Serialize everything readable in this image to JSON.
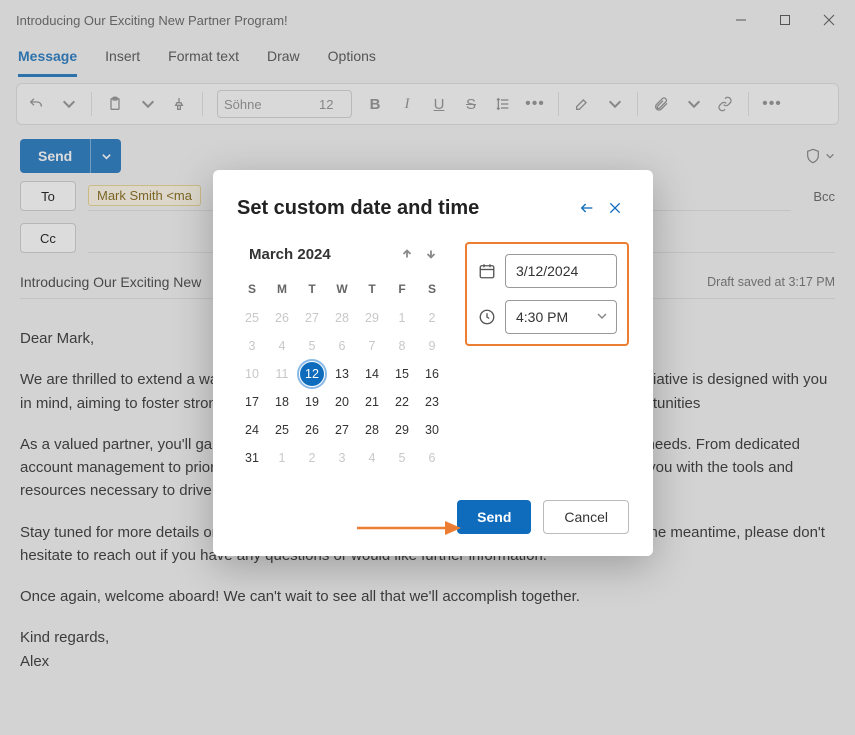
{
  "window": {
    "title": "Introducing Our Exciting New Partner Program!"
  },
  "tabs": {
    "items": [
      "Message",
      "Insert",
      "Format text",
      "Draw",
      "Options"
    ],
    "active": 0
  },
  "ribbon": {
    "font_name": "Söhne",
    "font_size": "12"
  },
  "send": {
    "label": "Send"
  },
  "recipients": {
    "to_label": "To",
    "cc_label": "Cc",
    "bcc_label": "Bcc",
    "to_chip": "Mark Smith <ma"
  },
  "subject": {
    "value": "Introducing Our Exciting New",
    "draft_note": "Draft saved at 3:17 PM"
  },
  "body": {
    "greeting": "Dear Mark,",
    "p1": "We are thrilled to extend a warm welcome to you as a member of our Partner Program! This initiative is designed with you in mind, aiming to foster strong, mutually beneficial relationships, and create unparalleled opportunities",
    "p2": "As a valued partner, you'll gain access to an array of exclusive benefits tailored to your unique needs. From dedicated account management to priority support and customized service, we're committed to providing you with the tools and resources necessary to drive your business landscape.",
    "p3": "Stay tuned for more details on upcoming events, webinars, and exclusive Partner Program. In the meantime, please don't hesitate to reach out if you have any questions or would like further information.",
    "p4": "Once again, welcome aboard! We can't wait to see all that we'll accomplish together.",
    "signoff": "Kind regards,\nAlex"
  },
  "modal": {
    "title": "Set custom date and time",
    "month": "March 2024",
    "dows": [
      "S",
      "M",
      "T",
      "W",
      "T",
      "F",
      "S"
    ],
    "weeks": [
      [
        {
          "n": 25,
          "dim": true
        },
        {
          "n": 26,
          "dim": true
        },
        {
          "n": 27,
          "dim": true
        },
        {
          "n": 28,
          "dim": true
        },
        {
          "n": 29,
          "dim": true
        },
        {
          "n": 1,
          "dim": true
        },
        {
          "n": 2,
          "dim": true
        }
      ],
      [
        {
          "n": 3,
          "dim": true
        },
        {
          "n": 4,
          "dim": true
        },
        {
          "n": 5,
          "dim": true
        },
        {
          "n": 6,
          "dim": true
        },
        {
          "n": 7,
          "dim": true
        },
        {
          "n": 8,
          "dim": true
        },
        {
          "n": 9,
          "dim": true
        }
      ],
      [
        {
          "n": 10,
          "dim": true
        },
        {
          "n": 11,
          "dim": true
        },
        {
          "n": 12,
          "sel": true
        },
        {
          "n": 13
        },
        {
          "n": 14
        },
        {
          "n": 15
        },
        {
          "n": 16
        }
      ],
      [
        {
          "n": 17
        },
        {
          "n": 18
        },
        {
          "n": 19
        },
        {
          "n": 20
        },
        {
          "n": 21
        },
        {
          "n": 22
        },
        {
          "n": 23
        }
      ],
      [
        {
          "n": 24
        },
        {
          "n": 25
        },
        {
          "n": 26
        },
        {
          "n": 27
        },
        {
          "n": 28
        },
        {
          "n": 29
        },
        {
          "n": 30
        }
      ],
      [
        {
          "n": 31
        },
        {
          "n": 1,
          "dim": true
        },
        {
          "n": 2,
          "dim": true
        },
        {
          "n": 3,
          "dim": true
        },
        {
          "n": 4,
          "dim": true
        },
        {
          "n": 5,
          "dim": true
        },
        {
          "n": 6,
          "dim": true
        }
      ]
    ],
    "date_value": "3/12/2024",
    "time_value": "4:30 PM",
    "send": "Send",
    "cancel": "Cancel"
  }
}
